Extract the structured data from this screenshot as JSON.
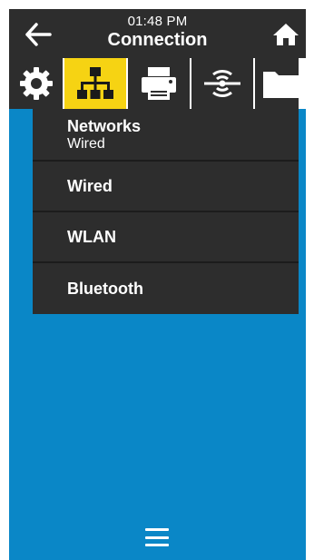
{
  "header": {
    "time": "01:48 PM",
    "title": "Connection",
    "back_icon": "arrow-left-icon",
    "home_icon": "home-icon"
  },
  "tabs": [
    {
      "icon": "settings-gear-icon",
      "active": false
    },
    {
      "icon": "network-icon",
      "active": true
    },
    {
      "icon": "printer-icon",
      "active": false
    },
    {
      "icon": "sensor-icon",
      "active": false
    },
    {
      "icon": "folder-icon",
      "active": false
    }
  ],
  "menu": {
    "items": [
      {
        "label": "Networks",
        "sublabel": "Wired"
      },
      {
        "label": "Wired"
      },
      {
        "label": "WLAN"
      },
      {
        "label": "Bluetooth"
      }
    ]
  },
  "footer": {
    "menu_icon": "hamburger-menu-icon"
  },
  "colors": {
    "background": "#0a87c7",
    "bar": "#2d2d2d",
    "active_tab": "#f6d313",
    "text": "#ffffff"
  }
}
